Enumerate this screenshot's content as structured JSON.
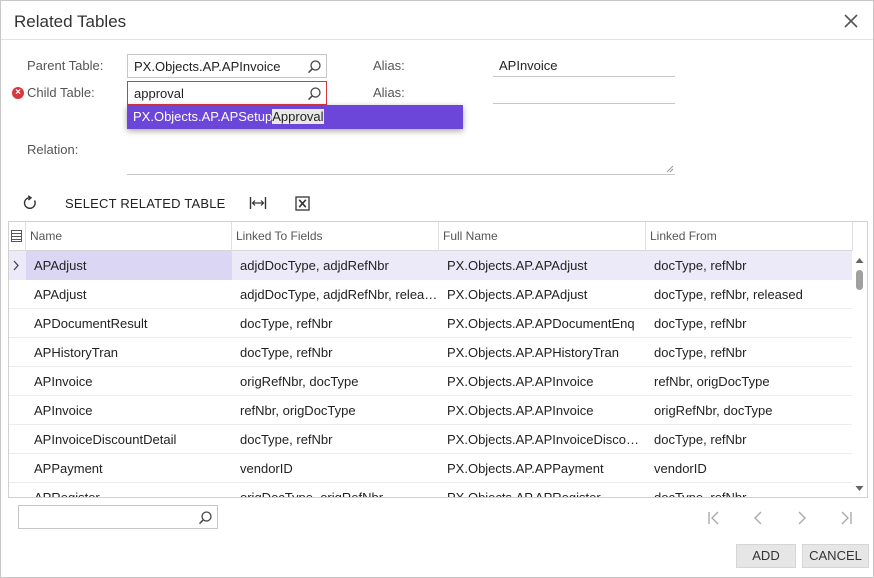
{
  "dialog": {
    "title": "Related Tables"
  },
  "form": {
    "parent_table_label": "Parent Table:",
    "parent_table_value": "PX.Objects.AP.APInvoice",
    "child_table_label": "Child Table:",
    "child_table_value": "approval",
    "alias_label": "Alias:",
    "alias_parent_value": "APInvoice",
    "alias_child_label": "Alias:",
    "alias_child_value": "",
    "relation_label": "Relation:",
    "suggestion_prefix": "PX.Objects.AP.APSetup",
    "suggestion_match": "Approval"
  },
  "toolbar": {
    "select_related_label": "SELECT RELATED TABLE"
  },
  "grid": {
    "columns": [
      "Name",
      "Linked To Fields",
      "Full Name",
      "Linked From"
    ],
    "rows": [
      {
        "name": "APAdjust",
        "linked": "adjdDocType, adjdRefNbr",
        "full": "PX.Objects.AP.APAdjust",
        "from": "docType, refNbr"
      },
      {
        "name": "APAdjust",
        "linked": "adjdDocType, adjdRefNbr, released",
        "full": "PX.Objects.AP.APAdjust",
        "from": "docType, refNbr, released"
      },
      {
        "name": "APDocumentResult",
        "linked": "docType, refNbr",
        "full": "PX.Objects.AP.APDocumentEnq",
        "from": "docType, refNbr"
      },
      {
        "name": "APHistoryTran",
        "linked": "docType, refNbr",
        "full": "PX.Objects.AP.APHistoryTran",
        "from": "docType, refNbr"
      },
      {
        "name": "APInvoice",
        "linked": "origRefNbr, docType",
        "full": "PX.Objects.AP.APInvoice",
        "from": "refNbr, origDocType"
      },
      {
        "name": "APInvoice",
        "linked": "refNbr, origDocType",
        "full": "PX.Objects.AP.APInvoice",
        "from": "origRefNbr, docType"
      },
      {
        "name": "APInvoiceDiscountDetail",
        "linked": "docType, refNbr",
        "full": "PX.Objects.AP.APInvoiceDiscountDetail",
        "from": "docType, refNbr"
      },
      {
        "name": "APPayment",
        "linked": "vendorID",
        "full": "PX.Objects.AP.APPayment",
        "from": "vendorID"
      },
      {
        "name": "APRegister",
        "linked": "origDocType, origRefNbr",
        "full": "PX.Objects.AP.APRegister",
        "from": "docType, refNbr"
      }
    ]
  },
  "footer": {
    "search_value": "",
    "add_label": "ADD",
    "cancel_label": "CANCEL"
  },
  "colors": {
    "accent": "#6b46d9",
    "error": "#d9363e",
    "selected_row": "#ece9f8"
  },
  "icons": [
    "close-icon",
    "search-icon",
    "error-icon",
    "refresh-icon",
    "fit-columns-icon",
    "excel-export-icon",
    "row-indicator-icon",
    "first-page-icon",
    "prev-page-icon",
    "next-page-icon",
    "last-page-icon"
  ]
}
